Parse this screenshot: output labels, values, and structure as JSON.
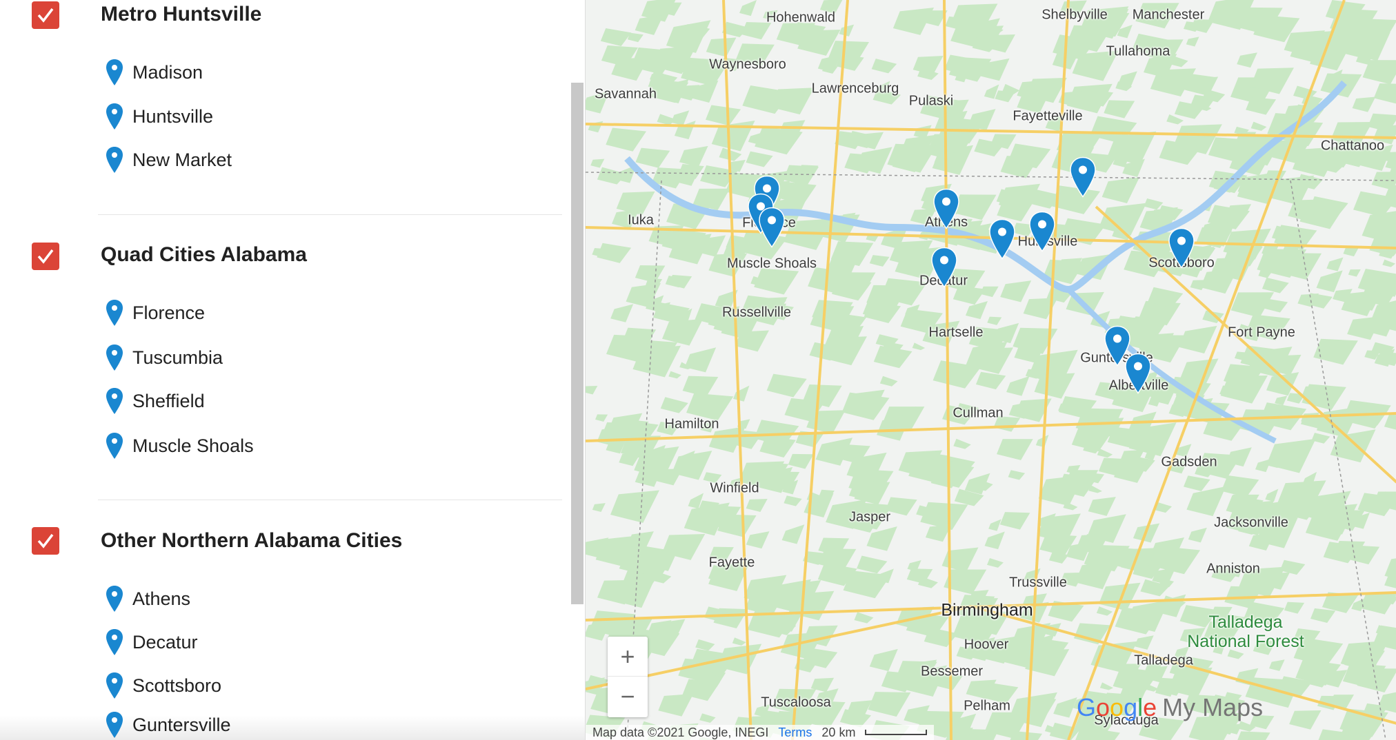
{
  "colors": {
    "checkbox": "#db4437",
    "pin": "#1a87d0",
    "land": "#f1f3f1",
    "forest": "#c9e8c4",
    "road": "#f6cf65",
    "water": "#a3ccf2"
  },
  "layers": [
    {
      "title": "Metro Huntsville",
      "checked": true,
      "items": [
        "Madison",
        "Huntsville",
        "New Market"
      ]
    },
    {
      "title": "Quad Cities Alabama",
      "checked": true,
      "items": [
        "Florence",
        "Tuscumbia",
        "Sheffield",
        "Muscle Shoals"
      ]
    },
    {
      "title": "Other Northern Alabama Cities",
      "checked": true,
      "items": [
        "Athens",
        "Decatur",
        "Scottsboro",
        "Guntersville"
      ]
    }
  ],
  "map": {
    "labels": [
      "Hohenwald",
      "Shelbyville",
      "Manchester",
      "Tullahoma",
      "Waynesboro",
      "Savannah",
      "Lawrenceburg",
      "Pulaski",
      "Fayetteville",
      "Chattanoo",
      "Iuka",
      "Florence",
      "Athens",
      "Huntsville",
      "Muscle Shoals",
      "Decatur",
      "Scottsboro",
      "Russellville",
      "Hartselle",
      "Fort Payne",
      "Guntersville",
      "Albertville",
      "Hamilton",
      "Cullman",
      "Gadsden",
      "Winfield",
      "Jasper",
      "Jacksonville",
      "Fayette",
      "Anniston",
      "Trussville",
      "Birmingham",
      "Hoover",
      "Talladega",
      "Bessemer",
      "Tuscaloosa",
      "Pelham",
      "Sylacauga"
    ],
    "forest_label": "Talladega National Forest",
    "zoom_in": "+",
    "zoom_out": "−",
    "attribution": "Map data ©2021 Google, INEGI",
    "terms": "Terms",
    "scale": "20 km",
    "logo": {
      "g": "G",
      "o1": "o",
      "o2": "o",
      "g2": "g",
      "l": "l",
      "e": "e",
      "suffix": "My Maps"
    }
  }
}
